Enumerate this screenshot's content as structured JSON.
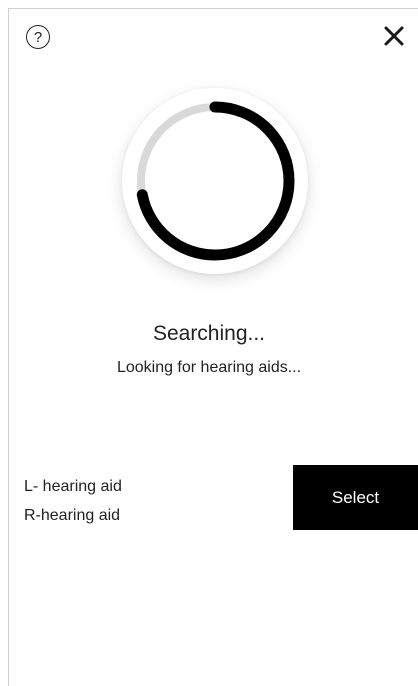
{
  "header": {
    "help_icon": "question-circle-icon",
    "help_glyph": "?",
    "close_icon": "close-icon"
  },
  "progress": {
    "fraction": 0.72,
    "track_color": "#d9d9d9",
    "arc_color": "#000000"
  },
  "status": {
    "title": "Searching...",
    "subtitle": "Looking for hearing aids..."
  },
  "devices": {
    "left_label": "L- hearing aid",
    "right_label": "R-hearing aid",
    "select_label": "Select"
  }
}
